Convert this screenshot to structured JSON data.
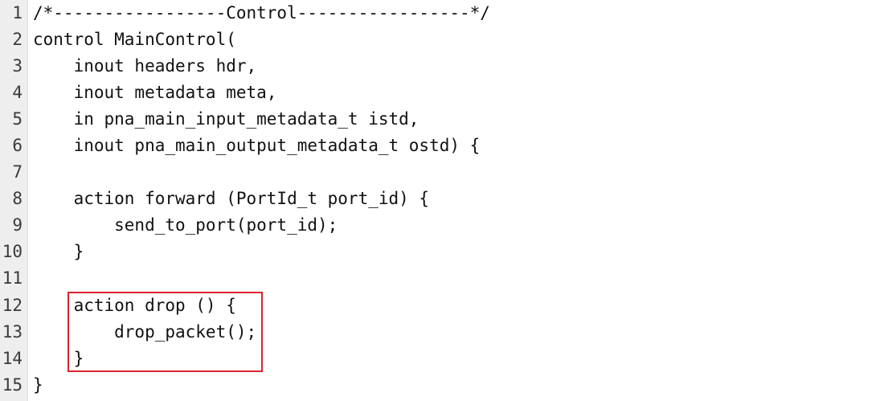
{
  "editor": {
    "highlight_color": "#d9232e",
    "lines": [
      {
        "n": "1",
        "text": "/*-----------------Control-----------------*/"
      },
      {
        "n": "2",
        "text": "control MainControl("
      },
      {
        "n": "3",
        "text": "    inout headers hdr,"
      },
      {
        "n": "4",
        "text": "    inout metadata meta,"
      },
      {
        "n": "5",
        "text": "    in pna_main_input_metadata_t istd,"
      },
      {
        "n": "6",
        "text": "    inout pna_main_output_metadata_t ostd) {"
      },
      {
        "n": "7",
        "text": ""
      },
      {
        "n": "8",
        "text": "    action forward (PortId_t port_id) {"
      },
      {
        "n": "9",
        "text": "        send_to_port(port_id);"
      },
      {
        "n": "10",
        "text": "    }"
      },
      {
        "n": "11",
        "text": ""
      },
      {
        "n": "12",
        "text": "    action drop () {"
      },
      {
        "n": "13",
        "text": "        drop_packet();"
      },
      {
        "n": "14",
        "text": "    }"
      },
      {
        "n": "15",
        "text": "}"
      }
    ]
  }
}
